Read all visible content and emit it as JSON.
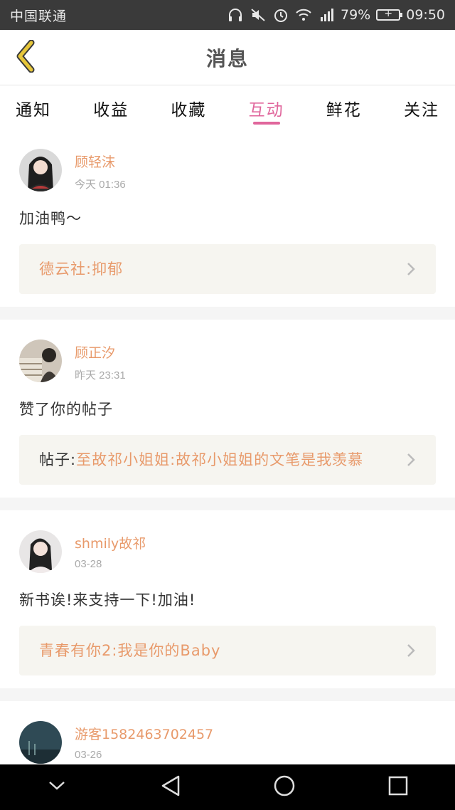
{
  "status_bar": {
    "carrier": "中国联通",
    "battery": "79%",
    "time": "09:50",
    "icons": [
      "headphones-icon",
      "mute-icon",
      "alarm-icon",
      "wifi-icon",
      "signal-icon",
      "battery-charging-icon"
    ]
  },
  "header": {
    "title": "消息",
    "back_icon": "chevron-left-icon",
    "accent_color": "#e6c63a"
  },
  "tabs": [
    {
      "label": "通知",
      "active": false
    },
    {
      "label": "收益",
      "active": false
    },
    {
      "label": "收藏",
      "active": false
    },
    {
      "label": "互动",
      "active": true
    },
    {
      "label": "鲜花",
      "active": false
    },
    {
      "label": "关注",
      "active": false
    }
  ],
  "colors": {
    "accent_pink": "#e0669c",
    "username_orange": "#e89a6b",
    "ref_box_bg": "#f6f5f0"
  },
  "feed": [
    {
      "username": "顾轻沫",
      "time": "今天 01:36",
      "comment": "加油鸭～",
      "ref_prefix": "",
      "ref_text": "德云社:抑郁"
    },
    {
      "username": "顾正汐",
      "time": "昨天 23:31",
      "comment": "赞了你的帖子",
      "ref_prefix": "帖子:",
      "ref_text": "至故祁小姐姐:故祁小姐姐的文笔是我羡慕"
    },
    {
      "username": "shmily故祁",
      "time": "03-28",
      "comment": "新书诶!来支持一下!加油!",
      "ref_prefix": "",
      "ref_text": "青春有你2:我是你的Baby"
    },
    {
      "username": "游客1582463702457",
      "time": "03-26"
    }
  ],
  "nav_bar": [
    "chevron-down-icon",
    "back-triangle-icon",
    "home-circle-icon",
    "recents-square-icon"
  ]
}
